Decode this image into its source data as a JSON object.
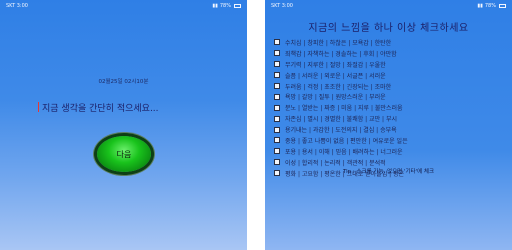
{
  "left": {
    "status": {
      "carrier": "SKT 3:00",
      "battery": "78%"
    },
    "date_time": "02월25일 02시10분",
    "prompt": "지금 생각을 간단히 적으세요...",
    "next_label": "다음"
  },
  "right": {
    "status": {
      "carrier": "SKT 3:00",
      "battery": "78%"
    },
    "title": "지금의 느낌을 하나 이상 체크하세요",
    "items": [
      "수치심 | 창피한 | 하찮은 | 모욕감 | 한탄한",
      "죄책감 | 자책하는 | 경솔하는 | 후회 | 야만함",
      "무기력 | 지루한 | 절망 | 좌절감 | 우울한",
      "슬픔 | 서러운 | 외로운 | 서글픈 | 서러운",
      "두려움 | 걱정 | 초조한 | 긴장되는 | 조마한",
      "욕망 | 갈망 | 질투 | 원망스러운 | 부러운",
      "분노 | 열받는 | 짜증 | 미움 | 지루 | 불만스러움",
      "자존심 | 멸시 | 경멸한 | 불쾌함 | 교만 | 부시",
      "용기내는 | 과감한 | 도전의지 | 결심 | 승부욕",
      "중용 | 좋고 나쁨이 없음 | 편안한 | 여유로운 일은",
      "포용 | 용서 | 이해 | 믿음 | 배려하는 | 너그러운",
      "이성 | 합리적 | 논리적 | 객관적 | 분석적",
      "평화 | 고요함 | 평온한 | 그대로 받아들임 | 평온"
    ],
    "tip": "Tip : 스크롤 가능, 없으면 '기타'에 체크",
    "next_label": "다음"
  }
}
